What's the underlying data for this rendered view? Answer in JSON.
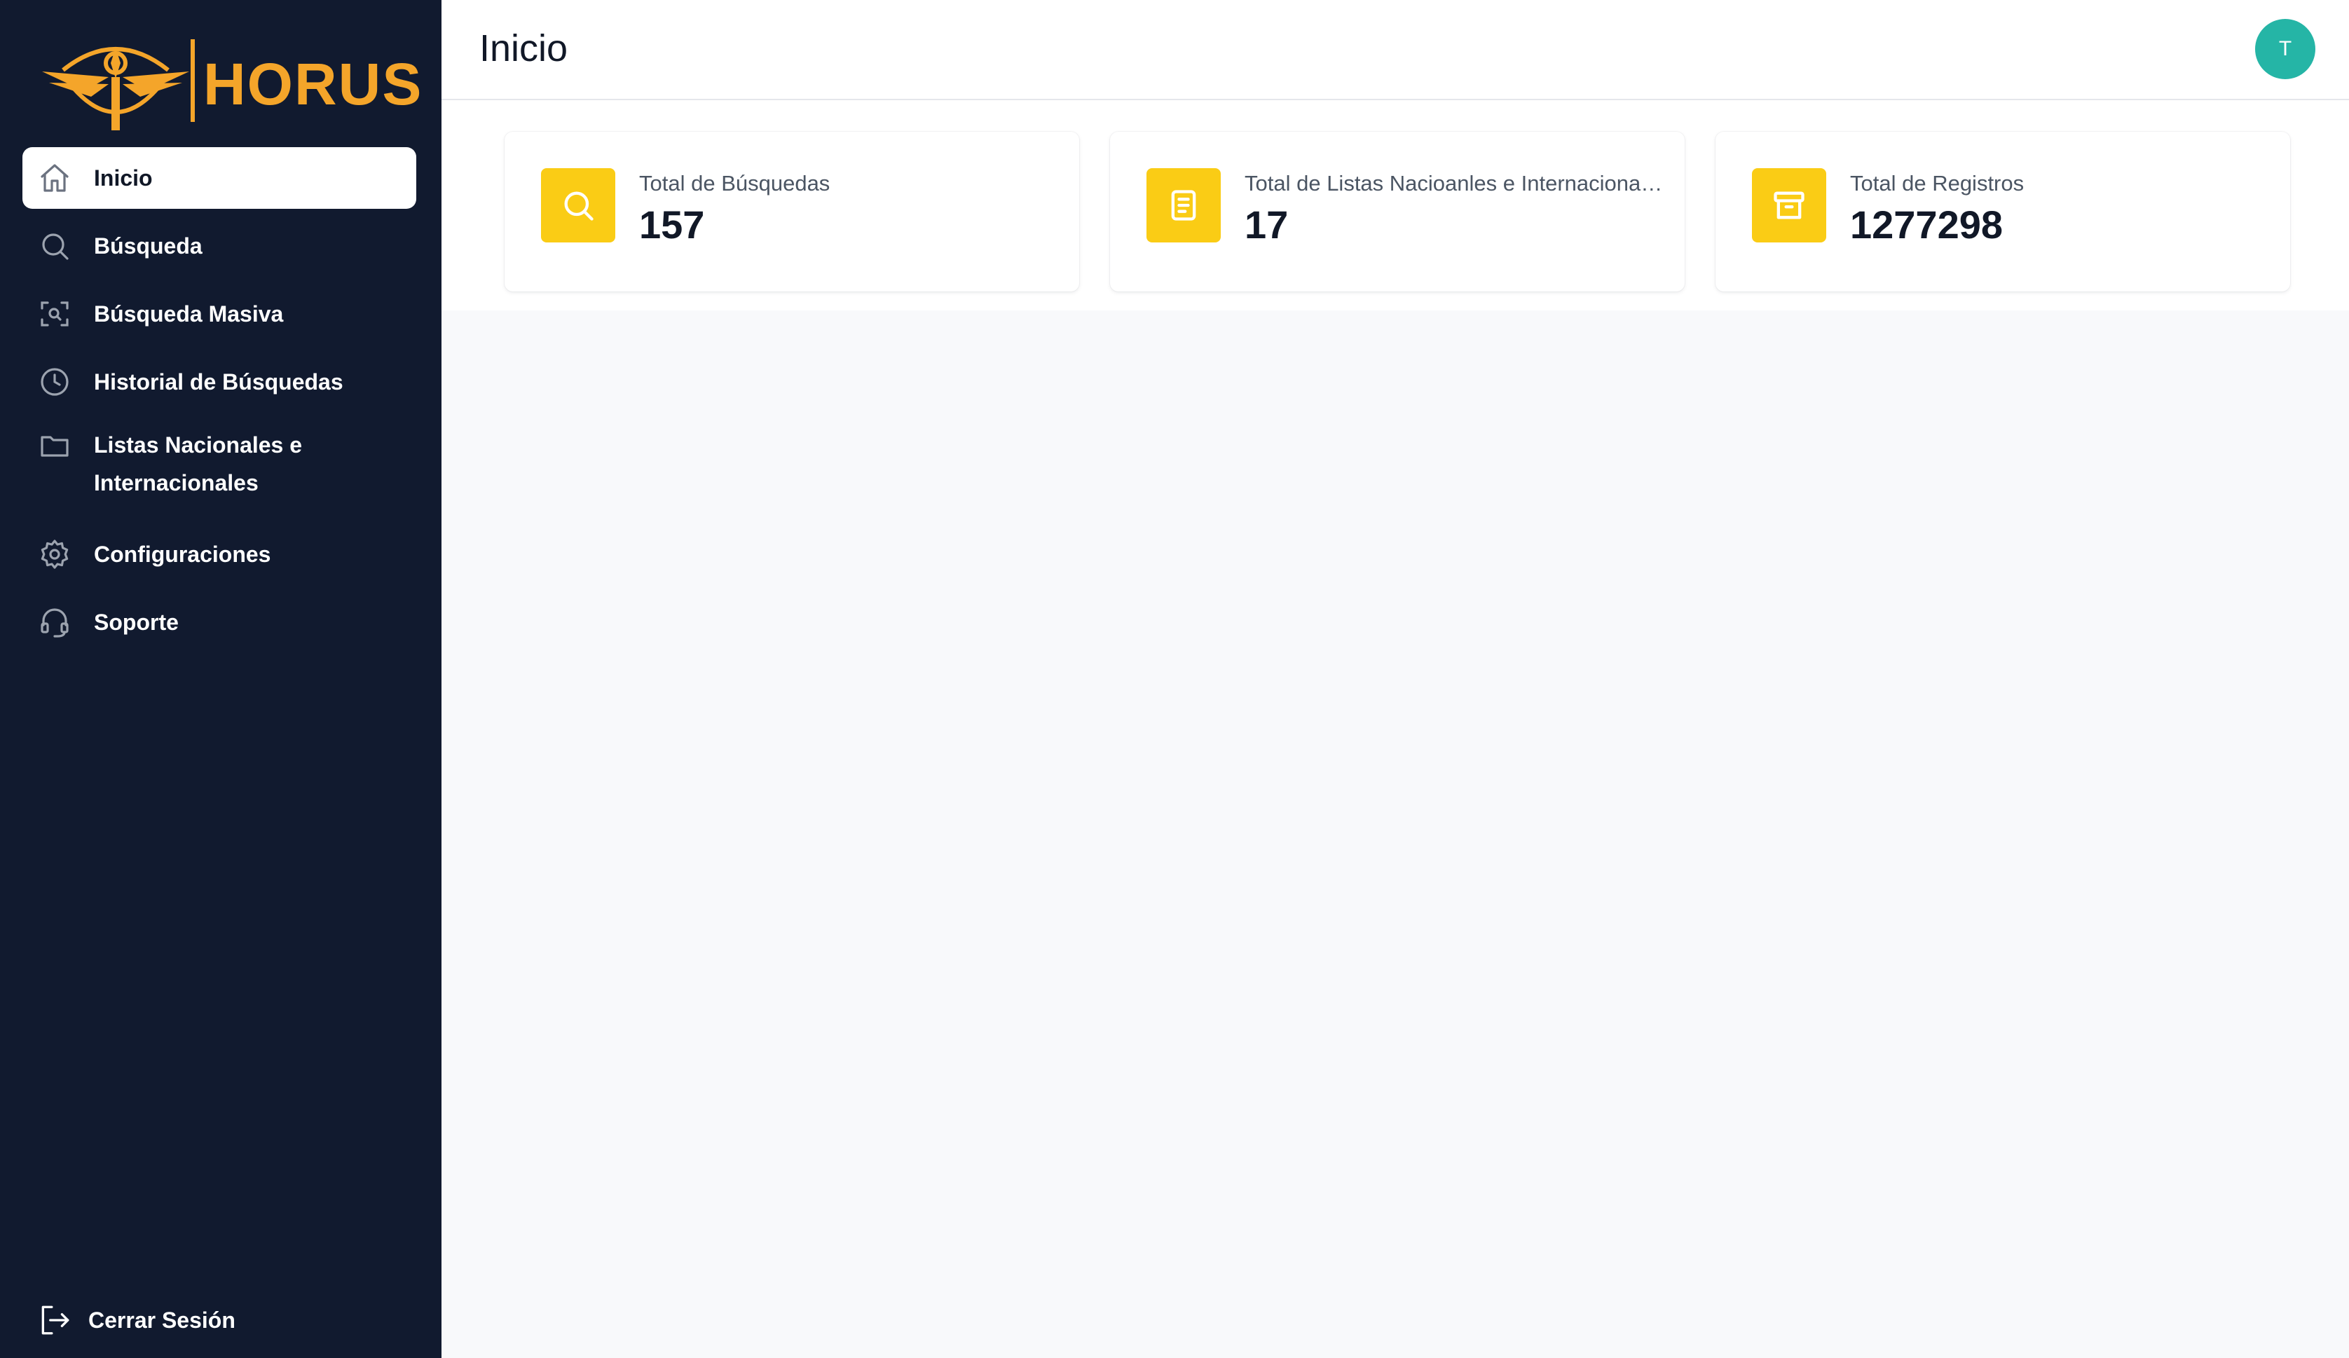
{
  "app": {
    "brand": "HORUS",
    "accent_color": "#F4A52A",
    "sidebar_bg": "#111A2F"
  },
  "sidebar": {
    "items": [
      {
        "label": "Inicio",
        "icon": "home-icon",
        "active": true
      },
      {
        "label": "Búsqueda",
        "icon": "search-icon",
        "active": false
      },
      {
        "label": "Búsqueda Masiva",
        "icon": "scan-search-icon",
        "active": false
      },
      {
        "label": "Historial de Búsquedas",
        "icon": "clock-icon",
        "active": false
      },
      {
        "label": "Listas Nacionales e Internacionales",
        "icon": "folder-icon",
        "active": false
      },
      {
        "label": "Configuraciones",
        "icon": "gear-icon",
        "active": false
      },
      {
        "label": "Soporte",
        "icon": "headset-icon",
        "active": false
      }
    ],
    "logout_label": "Cerrar Sesión",
    "logout_icon": "logout-icon"
  },
  "header": {
    "title": "Inicio",
    "avatar_initial": "T",
    "avatar_color": "#25B5A6"
  },
  "stats": [
    {
      "label": "Total de Búsquedas",
      "value": "157",
      "icon": "search-icon"
    },
    {
      "label": "Total de Listas Nacioanles e Internacionales",
      "value": "17",
      "icon": "document-icon"
    },
    {
      "label": "Total de Registros",
      "value": "1277298",
      "icon": "archive-icon"
    }
  ],
  "stat_icon_color": "#FACC15"
}
